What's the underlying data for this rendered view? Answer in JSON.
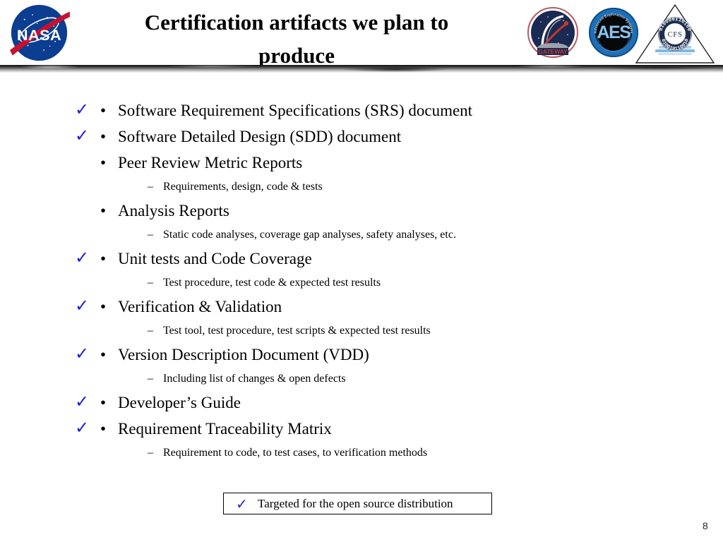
{
  "slide": {
    "title": "Certification artifacts we plan to produce",
    "title_line1": "Certification artifacts we plan to",
    "title_line2": "produce",
    "page_number": "8",
    "background_color": "#ffffff",
    "check_color": "#1c1ce0"
  },
  "logos": {
    "nasa": {
      "name": "NASA",
      "wordmark": "NASA"
    },
    "gateway": {
      "name": "Gateway",
      "wordmark": "GATEWAY"
    },
    "aes": {
      "name": "Advanced Exploration Systems",
      "wordmark": "AES",
      "ring_text": "Advanced Exploration Systems"
    },
    "cfs": {
      "name": "core Flight System",
      "wordmark": "CFS",
      "ring_text": "01000011010010011010010"
    }
  },
  "bullets": [
    {
      "level": 1,
      "marker": "•",
      "checked": true,
      "text": "Software Requirement Specifications (SRS) document"
    },
    {
      "level": 1,
      "marker": "•",
      "checked": true,
      "text": "Software Detailed Design (SDD) document"
    },
    {
      "level": 1,
      "marker": "•",
      "checked": false,
      "text": "Peer Review Metric Reports"
    },
    {
      "level": 2,
      "marker": "–",
      "checked": false,
      "text": "Requirements, design, code & tests"
    },
    {
      "level": 1,
      "marker": "•",
      "checked": false,
      "text": "Analysis Reports"
    },
    {
      "level": 2,
      "marker": "–",
      "checked": false,
      "text": "Static code analyses, coverage gap analyses, safety analyses, etc."
    },
    {
      "level": 1,
      "marker": "•",
      "checked": true,
      "text": "Unit tests and Code Coverage"
    },
    {
      "level": 2,
      "marker": "–",
      "checked": false,
      "text": "Test procedure, test code & expected test results"
    },
    {
      "level": 1,
      "marker": "•",
      "checked": true,
      "text": "Verification & Validation"
    },
    {
      "level": 2,
      "marker": "–",
      "checked": false,
      "text": "Test tool, test procedure, test scripts & expected test results"
    },
    {
      "level": 1,
      "marker": "•",
      "checked": true,
      "text": "Version Description Document (VDD)"
    },
    {
      "level": 2,
      "marker": "–",
      "checked": false,
      "text": "Including list of changes & open defects"
    },
    {
      "level": 1,
      "marker": "•",
      "checked": true,
      "text": "Developer’s Guide"
    },
    {
      "level": 1,
      "marker": "•",
      "checked": true,
      "text": "Requirement Traceability Matrix"
    },
    {
      "level": 2,
      "marker": "–",
      "checked": false,
      "text": "Requirement to code, to test cases, to verification methods"
    }
  ],
  "legend": {
    "check_glyph": "✓",
    "text": "Targeted for the open source distribution"
  },
  "glyphs": {
    "check": "✓"
  }
}
